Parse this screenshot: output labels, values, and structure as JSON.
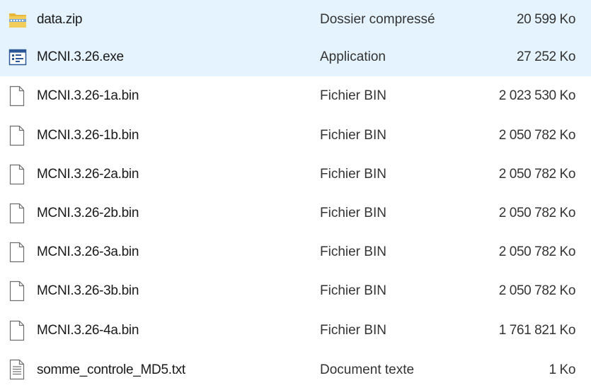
{
  "files": [
    {
      "name": "data.zip",
      "type": "Dossier compressé",
      "size": "20 599 Ko",
      "icon": "zip-folder-icon"
    },
    {
      "name": "MCNI.3.26.exe",
      "type": "Application",
      "size": "27 252 Ko",
      "icon": "application-icon",
      "selected": true
    },
    {
      "name": "MCNI.3.26-1a.bin",
      "type": "Fichier BIN",
      "size": "2 023 530 Ko",
      "icon": "file-icon"
    },
    {
      "name": "MCNI.3.26-1b.bin",
      "type": "Fichier BIN",
      "size": "2 050 782 Ko",
      "icon": "file-icon"
    },
    {
      "name": "MCNI.3.26-2a.bin",
      "type": "Fichier BIN",
      "size": "2 050 782 Ko",
      "icon": "file-icon"
    },
    {
      "name": "MCNI.3.26-2b.bin",
      "type": "Fichier BIN",
      "size": "2 050 782 Ko",
      "icon": "file-icon"
    },
    {
      "name": "MCNI.3.26-3a.bin",
      "type": "Fichier BIN",
      "size": "2 050 782 Ko",
      "icon": "file-icon"
    },
    {
      "name": "MCNI.3.26-3b.bin",
      "type": "Fichier BIN",
      "size": "2 050 782 Ko",
      "icon": "file-icon"
    },
    {
      "name": "MCNI.3.26-4a.bin",
      "type": "Fichier BIN",
      "size": "1 761 821 Ko",
      "icon": "file-icon"
    },
    {
      "name": "somme_controle_MD5.txt",
      "type": "Document texte",
      "size": "1 Ko",
      "icon": "text-document-icon"
    }
  ],
  "colors": {
    "selection": "#e5f3ff",
    "zip_folder": "#f0c44c",
    "text": "#1a1a1a"
  }
}
